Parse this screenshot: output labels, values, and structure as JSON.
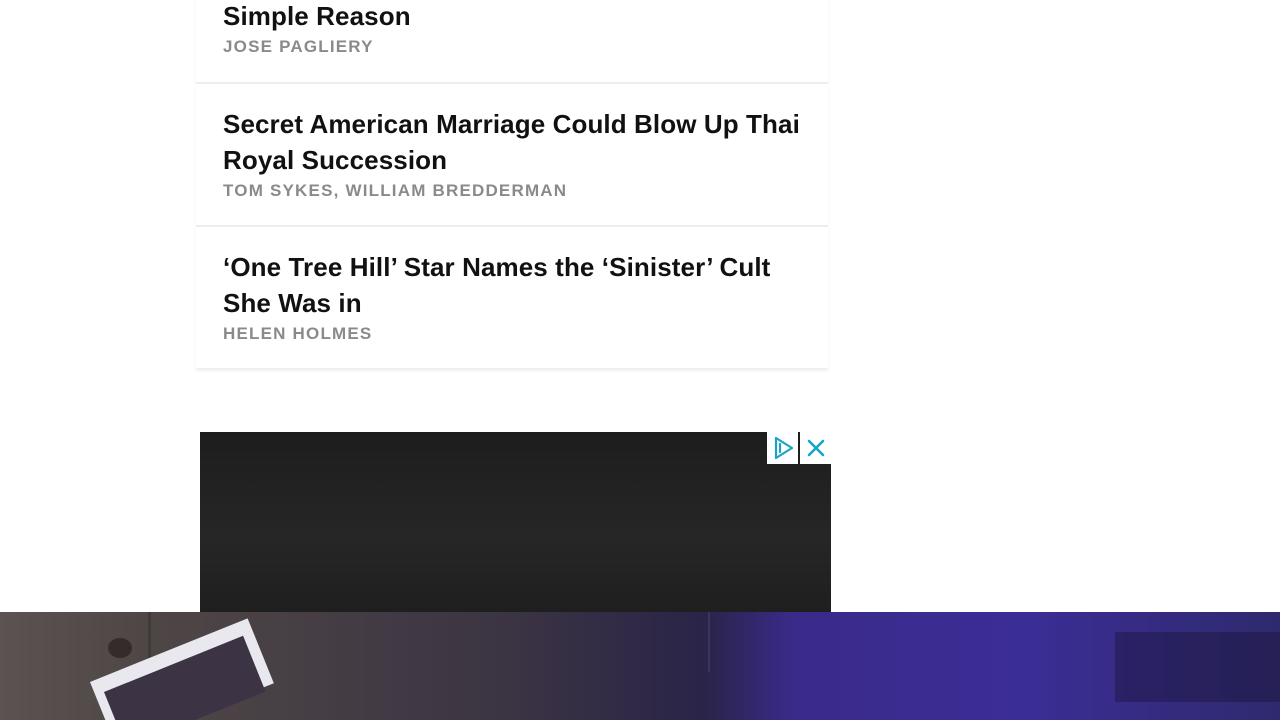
{
  "stories": [
    {
      "headline": "Simple Reason",
      "byline": "JOSE PAGLIERY"
    },
    {
      "headline": "Secret American Marriage Could Blow Up Thai Royal Succession",
      "byline": "TOM SYKES, WILLIAM BREDDERMAN"
    },
    {
      "headline": "‘One Tree Hill’ Star Names the ‘Sinister’ Cult She Was in",
      "byline": "HELEN HOLMES"
    }
  ],
  "ad": {
    "adchoices_icon": "adchoices-icon",
    "close_icon": "close-icon",
    "accent_color": "#1aa3c9"
  },
  "colors": {
    "headline": "#111111",
    "byline": "#8a8a8a",
    "banner_purple": "#3b2d96"
  }
}
